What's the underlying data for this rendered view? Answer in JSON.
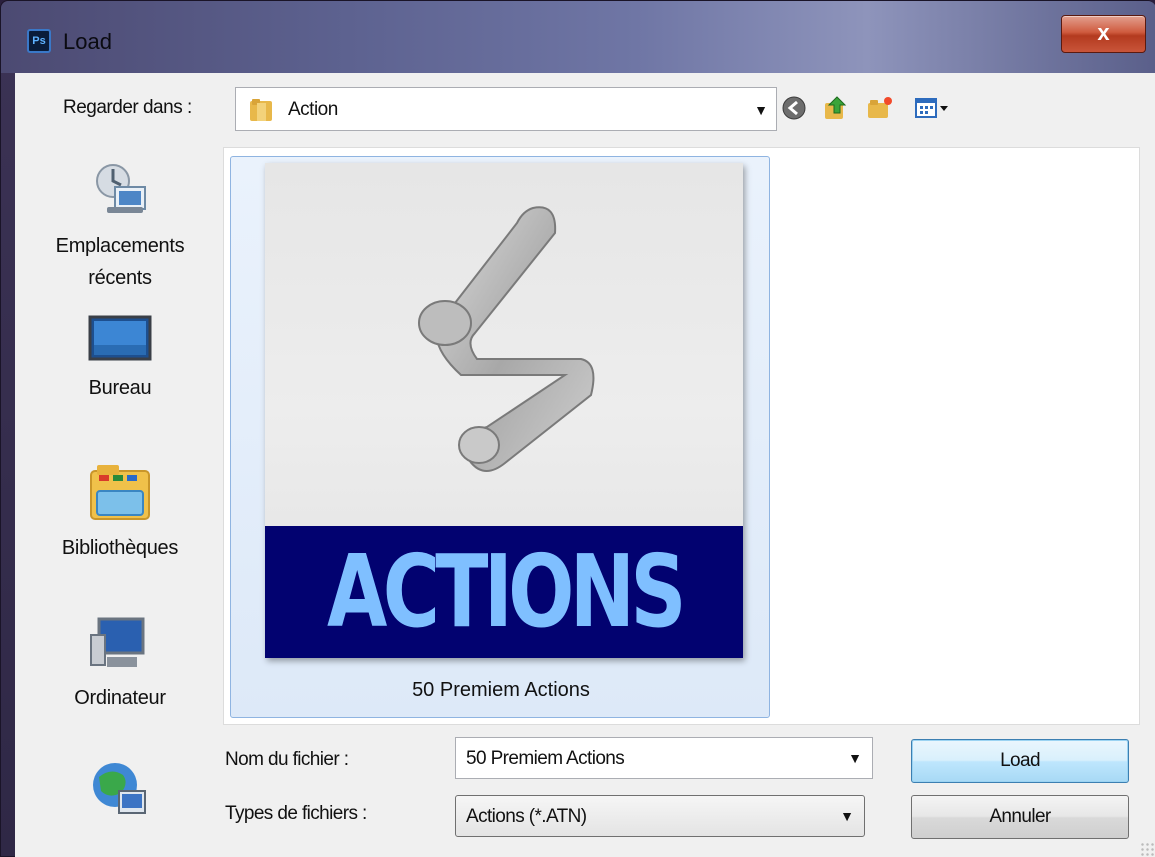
{
  "window": {
    "app_badge": "Ps",
    "title": "Load",
    "close_label": "x"
  },
  "lookin": {
    "label": "Regarder dans :",
    "value": "Action"
  },
  "places": [
    {
      "label": "Emplacements récents",
      "line1": "Emplacements",
      "line2": "récents",
      "icon": "recent-places-icon"
    },
    {
      "label": "Bureau",
      "icon": "desktop-icon"
    },
    {
      "label": "Bibliothèques",
      "icon": "libraries-icon"
    },
    {
      "label": "Ordinateur",
      "icon": "computer-icon"
    },
    {
      "label": "",
      "icon": "network-icon"
    }
  ],
  "files": [
    {
      "name": "50 Premiem Actions",
      "thumbnail_text": "ACTIONS",
      "selected": true
    }
  ],
  "filename": {
    "label": "Nom du fichier :",
    "value": "50 Premiem Actions"
  },
  "filetype": {
    "label": "Types de fichiers :",
    "value": "Actions (*.ATN)"
  },
  "buttons": {
    "load": "Load",
    "cancel": "Annuler"
  },
  "colors": {
    "thumbnail_banner": "#020270",
    "thumbnail_text": "#7fbfff",
    "selection": "#dde9f8",
    "close_button": "#c9553a"
  }
}
